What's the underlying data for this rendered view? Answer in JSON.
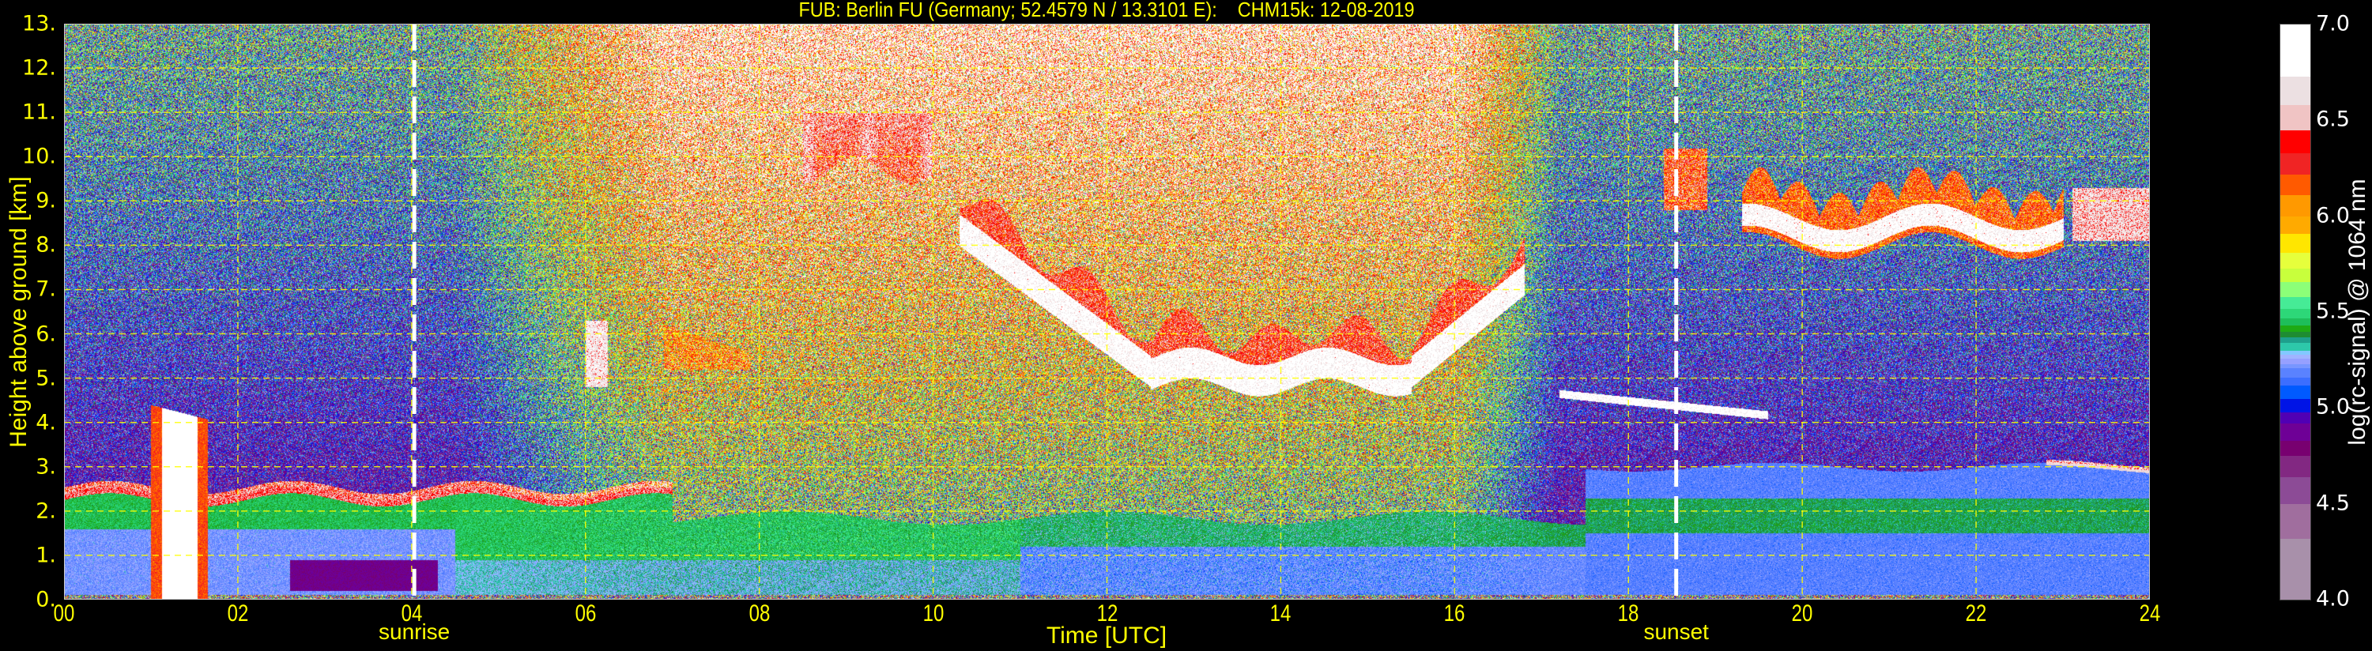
{
  "title": "FUB: Berlin FU (Germany; 52.4579 N / 13.3101 E):    CHM15k: 12-08-2019",
  "chart_data": {
    "type": "heatmap",
    "title": "FUB: Berlin FU (Germany; 52.4579 N / 13.3101 E):    CHM15k: 12-08-2019",
    "xlabel": "Time [UTC]",
    "ylabel": "Height above ground [km]",
    "xlim": [
      0,
      24
    ],
    "ylim": [
      0,
      13
    ],
    "xticks": [
      "00",
      "02",
      "04",
      "06",
      "08",
      "10",
      "12",
      "14",
      "16",
      "18",
      "20",
      "22",
      "24"
    ],
    "yticks": [
      "0.",
      "1.",
      "2.",
      "3.",
      "4.",
      "5.",
      "6.",
      "7.",
      "8.",
      "9.",
      "10.",
      "11.",
      "12.",
      "13."
    ],
    "grid": true,
    "grid_color": "#ffff00",
    "annotations": [
      {
        "label": "sunrise",
        "time": 4.03
      },
      {
        "label": "sunset",
        "time": 18.55
      }
    ],
    "colorbar": {
      "label": "log(rc-signal) @ 1064 nm",
      "range": [
        4.0,
        7.0
      ],
      "ticks": [
        "4.0",
        "4.5",
        "5.0",
        "5.5",
        "6.0",
        "6.5",
        "7.0"
      ],
      "levels": [
        4.0,
        4.32,
        4.5,
        4.64,
        4.75,
        4.83,
        4.92,
        4.98,
        5.05,
        5.12,
        5.16,
        5.21,
        5.23,
        5.26,
        5.28,
        5.3,
        5.34,
        5.37,
        5.4,
        5.43,
        5.47,
        5.52,
        5.58,
        5.66,
        5.73,
        5.81,
        5.91,
        6.0,
        6.11,
        6.22,
        6.33,
        6.45,
        6.58,
        6.73,
        7.0
      ],
      "colors": [
        "#a890aa",
        "#a06e9e",
        "#8c4b96",
        "#822882",
        "#780070",
        "#6e0096",
        "#5000b4",
        "#0014e6",
        "#005aff",
        "#3c6eff",
        "#5a82ff",
        "#7896ff",
        "#96a0ff",
        "#a0b4ff",
        "#82c8ff",
        "#2dc8aa",
        "#1ea08c",
        "#1e8c32",
        "#1eaa14",
        "#1ebe5a",
        "#2dd778",
        "#46eb96",
        "#8cff78",
        "#c8ff3c",
        "#e6ff3c",
        "#ffe600",
        "#ffaa00",
        "#ff9900",
        "#ff5a00",
        "#f02424",
        "#ff0000",
        "#f0c4c4",
        "#ece0e2",
        "#ffffff"
      ]
    },
    "layers": [
      {
        "type": "cloud",
        "time": [
          1.0,
          1.65
        ],
        "height": [
          0.1,
          4.4
        ]
      },
      {
        "type": "aerosol-top",
        "time": [
          0,
          7.0
        ],
        "height": [
          2.2,
          2.6
        ]
      },
      {
        "type": "cloud",
        "time": [
          6.0,
          6.25
        ],
        "height": [
          4.8,
          6.3
        ]
      },
      {
        "type": "cloud",
        "time": [
          6.9,
          7.9
        ],
        "height": [
          5.2,
          6.3
        ]
      },
      {
        "type": "cirrus",
        "time": [
          8.5,
          10.0
        ],
        "height": [
          9.7,
          11.0
        ]
      },
      {
        "type": "cirrus",
        "time": [
          10.3,
          16.8
        ],
        "height": [
          4.8,
          8.6
        ]
      },
      {
        "type": "cloud",
        "time": [
          17.2,
          19.6
        ],
        "height": [
          4.1,
          4.7
        ]
      },
      {
        "type": "cirrus",
        "time": [
          18.4,
          18.9
        ],
        "height": [
          8.8,
          10.2
        ]
      },
      {
        "type": "cirrus",
        "time": [
          19.3,
          24.0
        ],
        "height": [
          7.3,
          9.8
        ]
      }
    ]
  }
}
